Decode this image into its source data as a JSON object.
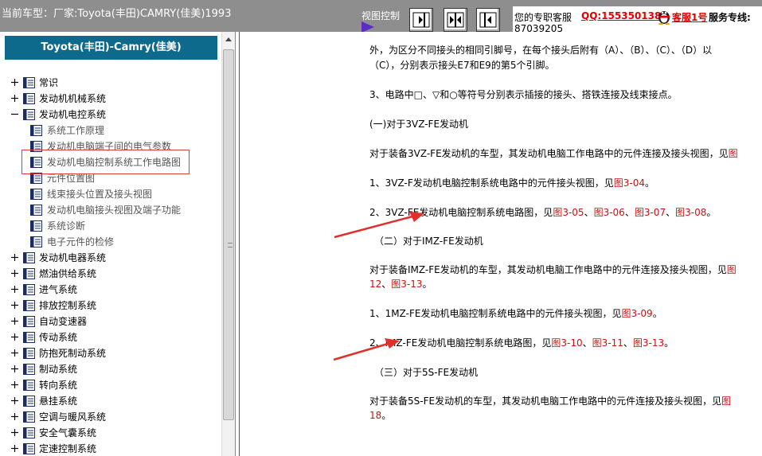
{
  "topbar": {
    "car_info": "当前车型：厂家:Toyota(丰田)CAMRY(佳美)1993",
    "view_control_label": "视图控制",
    "service": {
      "text": "您的专职客服",
      "qq": "QQ:1553501388",
      "kefu": "客服1号",
      "line_label": "服务专线:",
      "phone": "87039205"
    }
  },
  "sidebar": {
    "title": "Toyota(丰田)-Camry(佳美)",
    "items": [
      {
        "label": "常识",
        "level": 0,
        "expander": "plus"
      },
      {
        "label": "发动机机械系统",
        "level": 0,
        "expander": "plus"
      },
      {
        "label": "发动机电控系统",
        "level": 0,
        "expander": "minus"
      },
      {
        "label": "系统工作原理",
        "level": 1
      },
      {
        "label": "发动机电脑端子间的电气参数",
        "level": 1
      },
      {
        "label": "发动机电脑控制系统工作电路图",
        "level": 1
      },
      {
        "label": "元件位置图",
        "level": 1
      },
      {
        "label": "线束接头位置及接头视图",
        "level": 1
      },
      {
        "label": "发动机电脑接头视图及端子功能",
        "level": 1
      },
      {
        "label": "系统诊断",
        "level": 1
      },
      {
        "label": "电子元件的检修",
        "level": 1
      },
      {
        "label": "发动机电器系统",
        "level": 0,
        "expander": "plus"
      },
      {
        "label": "燃油供给系统",
        "level": 0,
        "expander": "plus"
      },
      {
        "label": "进气系统",
        "level": 0,
        "expander": "plus"
      },
      {
        "label": "排放控制系统",
        "level": 0,
        "expander": "plus"
      },
      {
        "label": "自动变速器",
        "level": 0,
        "expander": "plus"
      },
      {
        "label": "传动系统",
        "level": 0,
        "expander": "plus"
      },
      {
        "label": "防抱死制动系统",
        "level": 0,
        "expander": "plus"
      },
      {
        "label": "制动系统",
        "level": 0,
        "expander": "plus"
      },
      {
        "label": "转向系统",
        "level": 0,
        "expander": "plus"
      },
      {
        "label": "悬挂系统",
        "level": 0,
        "expander": "plus"
      },
      {
        "label": "空调与暖风系统",
        "level": 0,
        "expander": "plus"
      },
      {
        "label": "安全气囊系统",
        "level": 0,
        "expander": "plus"
      },
      {
        "label": "定速控制系统",
        "level": 0,
        "expander": "plus"
      }
    ]
  },
  "content": {
    "p1": "外，为区分不同接头的相同引脚号，在每个接头后附有（A）、（B）、（C）、（D）以",
    "p2": "（C），分别表示接头E7和E9的第5个引脚。",
    "p3": "3、电路中□、▽和○等符号分别表示插接的接头、搭铁连接及线束接点。",
    "h1": "(一)对于3VZ-FE发动机",
    "p4": "对于装备3VZ-FE发动机的车型，其发动机电脑工作电路中的元件连接及接头视图，见",
    "p4_link": "图",
    "p5": "1、3VZ-F发动机电脑控制系统电路中的元件接头视图，见",
    "p5_link": "图3-04",
    "p5_end": "。",
    "p6": "2、3VZ-FE发动机电脑控制系统电路图，见",
    "p6_links": [
      "图3-05",
      "图3-06",
      "图3-07",
      "图3-08"
    ],
    "sep": "、",
    "h2": "（二）对于IMZ-FE发动机",
    "p7": "对于装备IMZ-FE发动机的车型，其发动机电脑工作电路中的元件连接及接头视图，见",
    "p7_link": "图",
    "p7b_link1": "12",
    "p7b_link2": "图3-13",
    "p8": "1、1MZ-FE发动机电脑控制系统电路中的元件接头视图，见",
    "p8_link": "图3-09",
    "p9": "2、IMZ-FE发动机电脑控制系统电路图，见",
    "p9_links": [
      "图3-10",
      "图3-11",
      "图3-13"
    ],
    "h3": "（三）对于5S-FE发动机",
    "p10": "对于装备5S-FE发动机的车型，其发动机电脑工作电路中的元件连接及接头视图，见",
    "p10_link": "图",
    "p10b_link": "18"
  },
  "colors": {
    "topbar_bg": "#8e8e8e",
    "sidebar_header_bg": "#0d6a8c",
    "link_red": "#cc1111",
    "annotation_red": "#e0302a"
  }
}
